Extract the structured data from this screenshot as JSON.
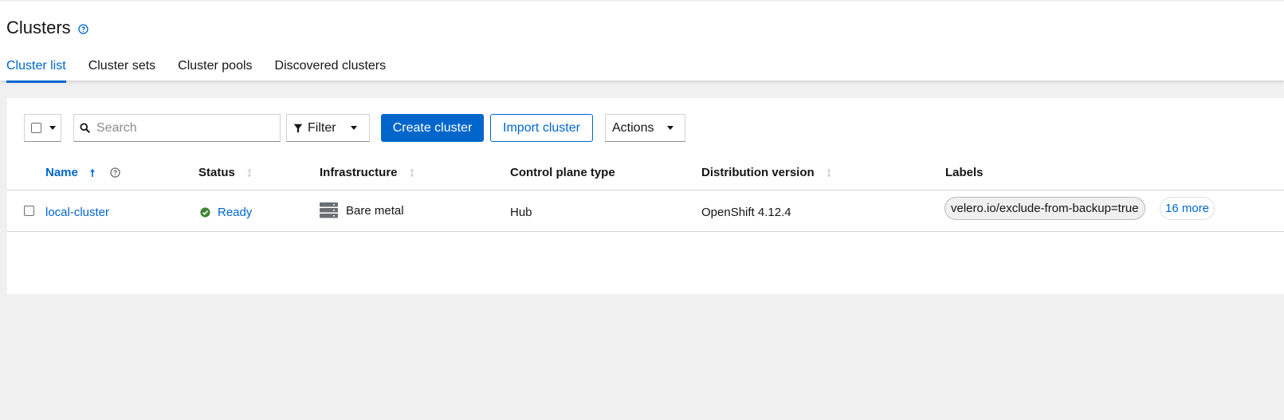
{
  "page": {
    "title": "Clusters",
    "tabs": [
      {
        "label": "Cluster list",
        "active": true
      },
      {
        "label": "Cluster sets",
        "active": false
      },
      {
        "label": "Cluster pools",
        "active": false
      },
      {
        "label": "Discovered clusters",
        "active": false
      }
    ]
  },
  "toolbar": {
    "search_placeholder": "Search",
    "filter_label": "Filter",
    "create_label": "Create cluster",
    "import_label": "Import cluster",
    "actions_label": "Actions"
  },
  "table": {
    "columns": [
      "Name",
      "Status",
      "Infrastructure",
      "Control plane type",
      "Distribution version",
      "Labels"
    ],
    "rows": [
      {
        "name": "local-cluster",
        "status": "Ready",
        "infrastructure": "Bare metal",
        "control_plane": "Hub",
        "distribution": "OpenShift 4.12.4",
        "label": "velero.io/exclude-from-backup=true",
        "more_labels": "16 more"
      }
    ]
  },
  "icons": {
    "help": "help-circle-icon",
    "search": "search-icon",
    "filter": "filter-icon",
    "status_ready": "check-circle-icon",
    "infrastructure": "server-icon"
  },
  "colors": {
    "accent": "#0066cc",
    "success": "#3e8635",
    "background": "#f0f0f0"
  }
}
